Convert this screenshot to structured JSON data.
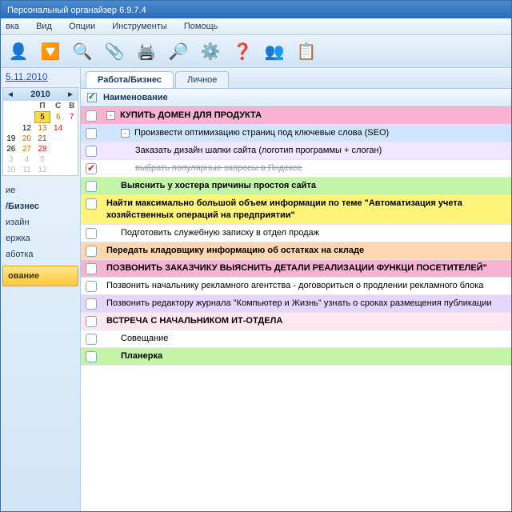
{
  "window": {
    "title": "Персональный органайзер 6.9.7.4"
  },
  "menu": {
    "items": [
      "вка",
      "Вид",
      "Опции",
      "Инструменты",
      "Помощь"
    ]
  },
  "toolbar": {
    "icons": [
      "👤",
      "🔽",
      "🔍",
      "📎",
      "🖨️",
      "🔎",
      "⚙️",
      "❓",
      "👥",
      "📋"
    ]
  },
  "dates": {
    "d1": "5.11.2010",
    "d2": "2010"
  },
  "calendar": {
    "month": "2010",
    "dow": [
      "",
      "",
      "П",
      "С",
      "В"
    ],
    "weeks": [
      [
        "",
        "",
        "5",
        "6",
        "7"
      ],
      [
        "",
        "12",
        "13",
        "14",
        ""
      ],
      [
        "19",
        "20",
        "21",
        "",
        ""
      ],
      [
        "26",
        "27",
        "28",
        "",
        ""
      ],
      [
        "3",
        "4",
        "5",
        "",
        ""
      ],
      [
        "10",
        "11",
        "12",
        "",
        ""
      ]
    ]
  },
  "categories": {
    "items": [
      "ие",
      "/Бизнес",
      "изайн",
      "ержка",
      "аботка"
    ],
    "active": "ование"
  },
  "tabs": {
    "t1": "Работа/Бизнес",
    "t2": "Личное"
  },
  "header": {
    "col": "Наименование"
  },
  "tasks": [
    {
      "bg": "bg-pink",
      "indent": 0,
      "exp": "-",
      "caps": true,
      "text": "КУПИТЬ ДОМЕН ДЛЯ ПРОДУКТА"
    },
    {
      "bg": "bg-blue",
      "indent": 1,
      "exp": "-",
      "text": "Произвести оптимизацию страниц под ключевые слова (SEO)"
    },
    {
      "bg": "bg-lav",
      "indent": 2,
      "text": "Заказать дизайн шапки сайта (логотип программы + слоган)"
    },
    {
      "bg": "bg-white",
      "indent": 2,
      "checked": true,
      "strike": true,
      "text": "выбрать популярные запросы в Яндексе"
    },
    {
      "bg": "bg-green",
      "indent": 1,
      "bold": true,
      "text": "Выяснить у хостера причины простоя сайта"
    },
    {
      "bg": "bg-yellow",
      "indent": 0,
      "bold": true,
      "text": "Найти максимально большой объем информации по теме \"Автоматизация учета хозяйственных операций на предприятии\""
    },
    {
      "bg": "bg-white",
      "indent": 1,
      "text": "Подготовить служебную записку в отдел продаж"
    },
    {
      "bg": "bg-coral",
      "indent": 0,
      "bold": true,
      "text": "Передать кладовщику информацию об остатках на складе"
    },
    {
      "bg": "bg-pink",
      "indent": 0,
      "caps": true,
      "text": "ПОЗВОНИТЬ ЗАКАЗЧИКУ ВЫЯСНИТЬ ДЕТАЛИ РЕАЛИЗАЦИИ ФУНКЦИ ПОСЕТИТЕЛЕЙ\""
    },
    {
      "bg": "bg-white",
      "indent": 0,
      "text": "Позвонить начальнику рекламного агентства - договориться о продлении рекламного блока"
    },
    {
      "bg": "bg-violet",
      "indent": 0,
      "text": "Позвонить редактору журнала \"Компьютер и Жизнь\" узнать о сроках размещения публикации"
    },
    {
      "bg": "bg-lpink",
      "indent": 0,
      "caps": true,
      "text": "ВСТРЕЧА С НАЧАЛЬНИКОМ ИТ-ОТДЕЛА"
    },
    {
      "bg": "bg-white",
      "indent": 1,
      "text": "Совещание"
    },
    {
      "bg": "bg-green",
      "indent": 1,
      "bold": true,
      "text": "Планерка"
    }
  ]
}
